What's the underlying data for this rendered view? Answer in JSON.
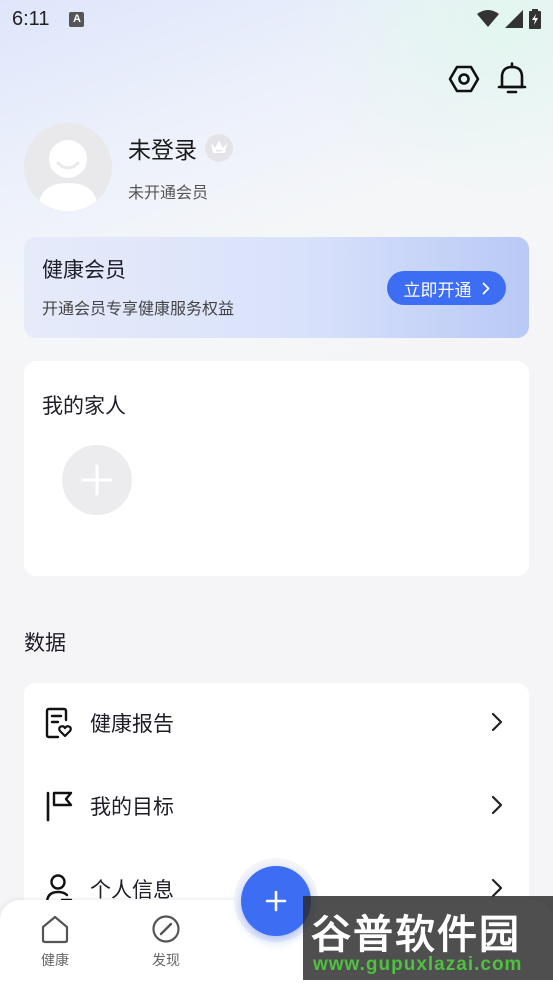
{
  "status_bar": {
    "time": "6:11",
    "notif_icon_letter": "A"
  },
  "header": {
    "settings_icon": "hexagon-settings-icon",
    "bell_icon": "bell-icon"
  },
  "profile": {
    "username": "未登录",
    "member_status": "未开通会员"
  },
  "vip": {
    "title": "健康会员",
    "subtitle": "开通会员专享健康服务权益",
    "button_label": "立即开通"
  },
  "family": {
    "title": "我的家人"
  },
  "data_section": {
    "title": "数据",
    "items": [
      {
        "label": "健康报告",
        "icon": "report-heart-icon"
      },
      {
        "label": "我的目标",
        "icon": "flag-icon"
      },
      {
        "label": "个人信息",
        "icon": "person-icon"
      }
    ]
  },
  "tabbar": {
    "tabs": [
      {
        "label": "健康",
        "icon": "home-icon"
      },
      {
        "label": "发现",
        "icon": "compass-icon"
      }
    ]
  },
  "watermark": {
    "text": "谷普软件园",
    "url": "www.gupuxlazai.com"
  },
  "colors": {
    "accent": "#3d6df2",
    "card_bg": "#ffffff",
    "page_bg": "#f5f5f7"
  }
}
